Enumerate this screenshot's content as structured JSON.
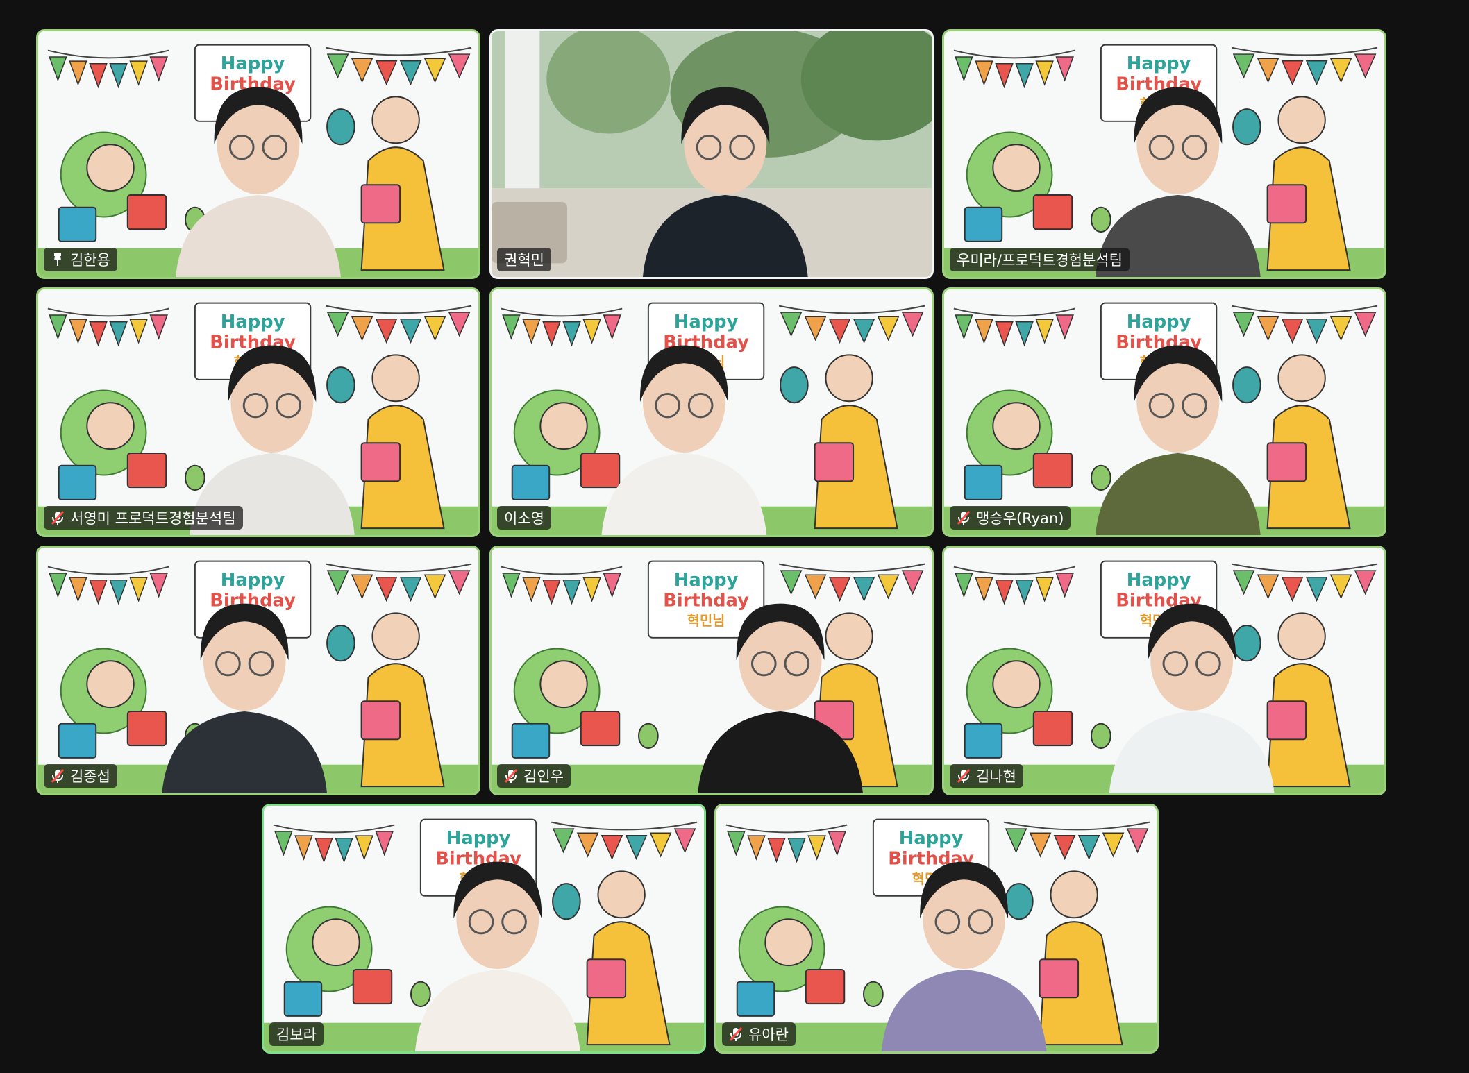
{
  "meeting": {
    "background": {
      "happy": "Happy",
      "birthday": "Birthday",
      "honoree": "혁민님"
    },
    "participants": [
      {
        "name": "김한용",
        "status": "pin-icon",
        "bg": "birthday",
        "speaking": false
      },
      {
        "name": "권혁민",
        "status": "",
        "bg": "forest-room",
        "speaking": false
      },
      {
        "name": "우미라/프로덕트경험분석팀",
        "status": "",
        "bg": "birthday",
        "speaking": false
      },
      {
        "name": "서영미 프로덕트경험분석팀",
        "status": "mic-muted-icon",
        "bg": "birthday",
        "speaking": false
      },
      {
        "name": "이소영",
        "status": "",
        "bg": "birthday",
        "speaking": false
      },
      {
        "name": "맹승우(Ryan)",
        "status": "mic-muted-icon",
        "bg": "birthday",
        "speaking": false
      },
      {
        "name": "김종섭",
        "status": "mic-muted-icon",
        "bg": "birthday",
        "speaking": false
      },
      {
        "name": "김인우",
        "status": "mic-muted-icon",
        "bg": "birthday",
        "speaking": false
      },
      {
        "name": "김나현",
        "status": "mic-muted-icon",
        "bg": "birthday",
        "speaking": false
      },
      {
        "name": "김보라",
        "status": "",
        "bg": "birthday",
        "speaking": true
      },
      {
        "name": "유아란",
        "status": "mic-muted-icon",
        "bg": "birthday",
        "speaking": false
      }
    ],
    "colors": {
      "window_bg": "#111111",
      "active_speaker_border": "#7fe08a",
      "mute_red": "#ff4d4d",
      "label_bg": "rgba(20,20,20,0.72)",
      "title_teal": "#2ea39a",
      "title_red": "#e2524a",
      "title_orange": "#e49a2a"
    }
  }
}
